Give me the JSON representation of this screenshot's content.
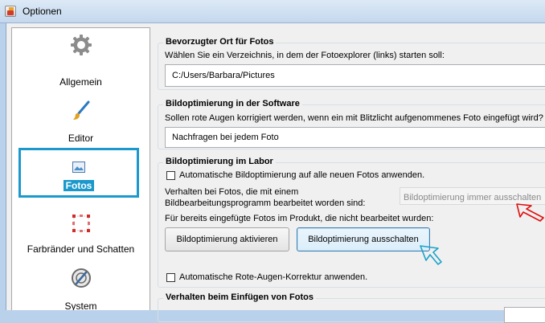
{
  "window": {
    "title": "Optionen"
  },
  "sidebar": {
    "items": [
      {
        "label": "Allgemein",
        "icon": "gear-icon"
      },
      {
        "label": "Editor",
        "icon": "brush-icon"
      },
      {
        "label": "Fotos",
        "icon": "photo-icon",
        "selected": true
      },
      {
        "label": "Farbränder und Schatten",
        "icon": "frame-shadow-icon"
      },
      {
        "label": "System",
        "icon": "system-icon"
      }
    ]
  },
  "groups": {
    "preferred_location": {
      "title": "Bevorzugter Ort für Fotos",
      "description": "Wählen Sie ein Verzeichnis, in dem der Fotoexplorer (links) starten soll:",
      "path": "C:/Users/Barbara/Pictures"
    },
    "software_optimization": {
      "title": "Bildoptimierung in der Software",
      "description": "Sollen rote Augen korrigiert werden, wenn ein mit Blitzlicht aufgenommenes Foto eingefügt wird?",
      "selected_value": "Nachfragen bei jedem Foto"
    },
    "lab_optimization": {
      "title": "Bildoptimierung im Labor",
      "auto_optimize_label": "Automatische Bildoptimierung auf alle neuen Fotos anwenden.",
      "edited_photos_label_line1": "Verhalten bei Fotos, die mit einem",
      "edited_photos_label_line2": "Bildbearbeitungsprogramm bearbeitet worden sind:",
      "edited_photos_value": "Bildoptimierung immer ausschalten",
      "unedited_photos_label": "Für bereits eingefügte Fotos im Produkt, die nicht bearbeitet wurden:",
      "activate_button": "Bildoptimierung aktivieren",
      "deactivate_button": "Bildoptimierung ausschalten",
      "auto_redeye_label": "Automatische Rote-Augen-Korrektur anwenden."
    },
    "insert_behavior": {
      "title": "Verhalten beim Einfügen von Fotos"
    }
  },
  "colors": {
    "selection_accent": "#1b99cc",
    "annotation_red": "#e01010",
    "annotation_cyan": "#1aa3c8"
  }
}
